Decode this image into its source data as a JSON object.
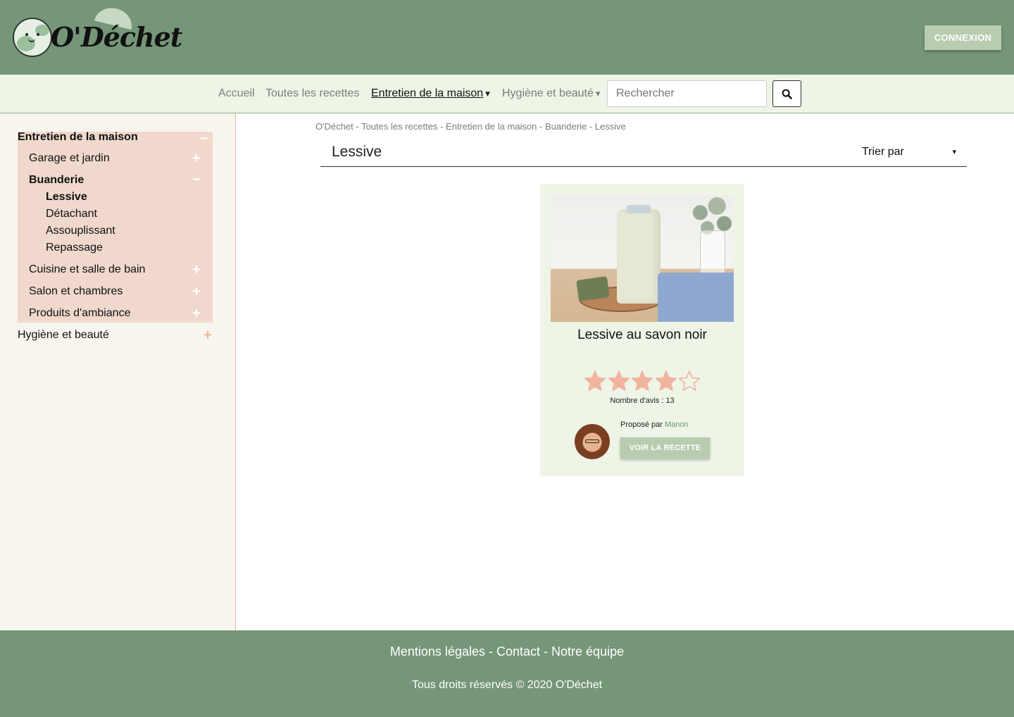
{
  "header": {
    "logo_text": "O'Déchet",
    "login_label": "CONNEXION"
  },
  "nav": {
    "items": [
      {
        "label": "Accueil",
        "active": false
      },
      {
        "label": "Toutes les recettes",
        "active": false
      },
      {
        "label": "Entretien de la maison",
        "active": true,
        "dropdown": true
      },
      {
        "label": "Hygiène et beauté",
        "active": false,
        "dropdown": true
      }
    ],
    "dropdown_caret": "▾",
    "search": {
      "placeholder": "Rechercher",
      "value": ""
    }
  },
  "sidebar": {
    "categories": [
      {
        "label": "Entretien de la maison",
        "expanded": true,
        "toggle": "−",
        "subcategories": [
          {
            "label": "Garage et jardin",
            "toggle": "+"
          },
          {
            "label": "Buanderie",
            "toggle": "−",
            "items": [
              {
                "label": "Lessive",
                "active": true
              },
              {
                "label": "Détachant"
              },
              {
                "label": "Assouplissant"
              },
              {
                "label": "Repassage"
              }
            ]
          },
          {
            "label": "Cuisine et salle de bain",
            "toggle": "+"
          },
          {
            "label": "Salon et chambres",
            "toggle": "+"
          },
          {
            "label": "Produits d'ambiance",
            "toggle": "+"
          }
        ]
      },
      {
        "label": "Hygiène et beauté",
        "expanded": false,
        "toggle": "+"
      }
    ]
  },
  "main": {
    "breadcrumb": "O'Déchet - Toutes les recettes - Entretien de la maison - Buanderie - Lessive",
    "title": "Lessive",
    "sort": {
      "label": "Trier par",
      "caret": "▾"
    },
    "recipe_card": {
      "title": "Lessive au savon noir",
      "rating": 4,
      "rating_max": 5,
      "reviews_text": "Nombre d'avis : 13",
      "proposed_by_label": "Proposé par",
      "author": "Manon",
      "button_label": "VOIR LA RECETTE"
    }
  },
  "footer": {
    "links": [
      "Mentions légales",
      "Contact",
      "Notre équipe"
    ],
    "separator": " - ",
    "copyright": "Tous droits réservés © 2020 O'Déchet"
  },
  "colors": {
    "header_green": "#759679",
    "nav_bg": "#eef4e6",
    "button_green": "#b8ccb0",
    "sidebar_bg": "#f8f5ef",
    "category_bg": "#f0d8cc",
    "star_pink": "#f0b49f"
  },
  "icons": {
    "search": "search-icon",
    "star_full": "star-filled-icon",
    "star_empty": "star-outline-icon",
    "expand": "plus-icon",
    "collapse": "minus-icon"
  }
}
